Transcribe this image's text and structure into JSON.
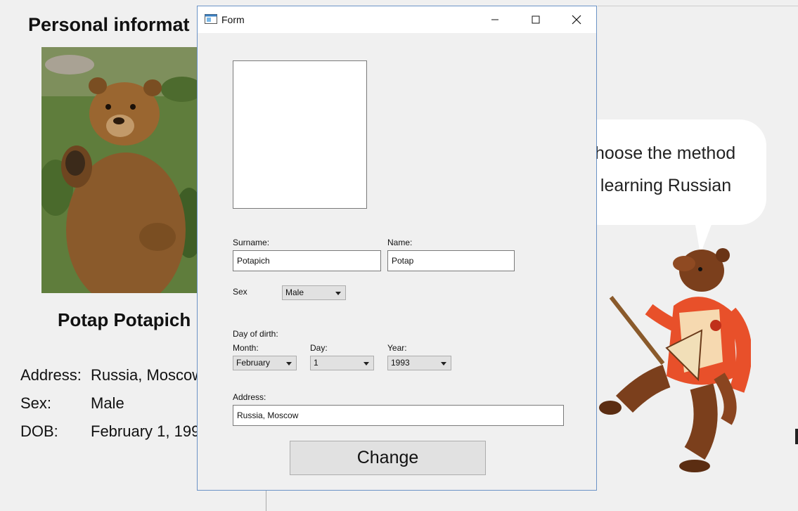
{
  "background": {
    "heading": "Personal informat",
    "person_name": "Potap Potapich",
    "address_label": "Address:",
    "address_value": "Russia, Moscow",
    "sex_label": "Sex:",
    "sex_value": "Male",
    "dob_label": "DOB:",
    "dob_value": "February 1, 199",
    "bubble_line1": "hoose the method",
    "bubble_line2": "f learning Russian"
  },
  "window": {
    "title": "Form",
    "icon": "form-app-icon",
    "controls": [
      "minimize-icon",
      "maximize-icon",
      "close-icon"
    ]
  },
  "form": {
    "surname_label": "Surname:",
    "surname_value": "Potapich",
    "name_label": "Name:",
    "name_value": "Potap",
    "sex_label": "Sex",
    "sex_value": "Male",
    "dob_heading": "Day of dirth:",
    "month_label": "Month:",
    "month_value": "February",
    "day_label": "Day:",
    "day_value": "1",
    "year_label": "Year:",
    "year_value": "1993",
    "address_label": "Address:",
    "address_value": "Russia, Moscow",
    "change_label": "Change"
  },
  "colors": {
    "window_border": "#6b93c6",
    "dialog_bg": "#f0f0f0",
    "button_bg": "#e1e1e1"
  }
}
